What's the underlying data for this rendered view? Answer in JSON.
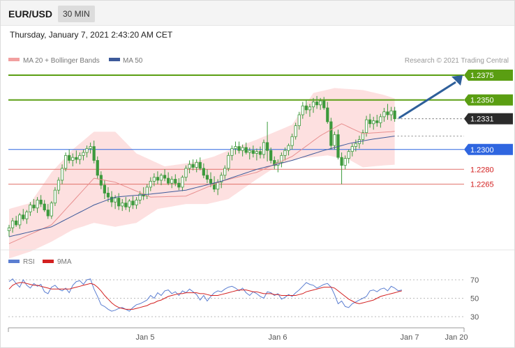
{
  "header": {
    "symbol": "EUR/USD",
    "timeframe": "30 MIN",
    "timestamp": "Thursday, January 7, 2021 2:43:20 AM CET"
  },
  "colors": {
    "candle": "#3c9a3c",
    "bollinger_fill": "#fde0e0",
    "ma20": "#e88f8f",
    "ma50": "#3d5a9a",
    "resistance_line": "#5a9e12",
    "support_line": "#2f66e0",
    "target_line": "#e0706a",
    "current_price_bg": "#2b2b2b",
    "arrow": "#2e5f9a",
    "rsi": "#5b7ed1",
    "rsi_ma": "#d32020"
  },
  "chart_data": [
    {
      "type": "candlestick",
      "legend": [
        "MA 20 + Bollinger Bands",
        "MA 50"
      ],
      "legend_position": "top-left",
      "credit": "Research © 2021 Trading Central",
      "x_ticks": [
        "Jan 5",
        "Jan 6",
        "Jan 7",
        "Jan 20"
      ],
      "price_levels": [
        {
          "label": "1.2375",
          "value": 1.2375,
          "kind": "resistance"
        },
        {
          "label": "1.2350",
          "value": 1.235,
          "kind": "resistance"
        },
        {
          "label": "1.2331",
          "value": 1.2331,
          "kind": "current"
        },
        {
          "label": "1.2300",
          "value": 1.23,
          "kind": "pivot"
        },
        {
          "label": "1.2280",
          "value": 1.228,
          "kind": "support"
        },
        {
          "label": "1.2265",
          "value": 1.2265,
          "kind": "support"
        }
      ],
      "arrow": {
        "from": 1.2331,
        "to": 1.2375,
        "direction": "up"
      },
      "candles": [
        [
          1.2218,
          1.2224,
          1.2212,
          1.2221
        ],
        [
          1.2221,
          1.2231,
          1.2216,
          1.2228
        ],
        [
          1.2228,
          1.2233,
          1.2222,
          1.2224
        ],
        [
          1.2224,
          1.2236,
          1.222,
          1.2234
        ],
        [
          1.2234,
          1.224,
          1.2228,
          1.223
        ],
        [
          1.223,
          1.2239,
          1.2225,
          1.2237
        ],
        [
          1.2237,
          1.2247,
          1.2233,
          1.2244
        ],
        [
          1.2244,
          1.225,
          1.2238,
          1.2241
        ],
        [
          1.2241,
          1.2252,
          1.2236,
          1.2249
        ],
        [
          1.2249,
          1.2254,
          1.2242,
          1.2245
        ],
        [
          1.2245,
          1.2249,
          1.2237,
          1.2239
        ],
        [
          1.2239,
          1.2245,
          1.223,
          1.2233
        ],
        [
          1.2233,
          1.2248,
          1.223,
          1.2246
        ],
        [
          1.2246,
          1.2262,
          1.2243,
          1.2259
        ],
        [
          1.2259,
          1.2272,
          1.2255,
          1.2269
        ],
        [
          1.2269,
          1.2285,
          1.2265,
          1.2281
        ],
        [
          1.2281,
          1.2297,
          1.2278,
          1.2294
        ],
        [
          1.2294,
          1.23,
          1.2286,
          1.2289
        ],
        [
          1.2289,
          1.2296,
          1.2283,
          1.2292
        ],
        [
          1.2292,
          1.2299,
          1.2286,
          1.229
        ],
        [
          1.229,
          1.2297,
          1.2285,
          1.2294
        ],
        [
          1.2294,
          1.23,
          1.2289,
          1.2297
        ],
        [
          1.2297,
          1.2304,
          1.2292,
          1.2301
        ],
        [
          1.2301,
          1.2307,
          1.2296,
          1.2303
        ],
        [
          1.2303,
          1.2309,
          1.2286,
          1.2289
        ],
        [
          1.2289,
          1.2293,
          1.227,
          1.2274
        ],
        [
          1.2274,
          1.2278,
          1.226,
          1.2264
        ],
        [
          1.2264,
          1.2269,
          1.225,
          1.2256
        ],
        [
          1.2256,
          1.2262,
          1.2247,
          1.2252
        ],
        [
          1.2252,
          1.2258,
          1.2242,
          1.2247
        ],
        [
          1.2247,
          1.2254,
          1.224,
          1.2251
        ],
        [
          1.2251,
          1.2256,
          1.2239,
          1.2243
        ],
        [
          1.2243,
          1.225,
          1.2238,
          1.2246
        ],
        [
          1.2246,
          1.2252,
          1.2239,
          1.2242
        ],
        [
          1.2242,
          1.225,
          1.2237,
          1.2248
        ],
        [
          1.2248,
          1.2253,
          1.224,
          1.2244
        ],
        [
          1.2244,
          1.2252,
          1.224,
          1.2249
        ],
        [
          1.2249,
          1.2258,
          1.2245,
          1.2255
        ],
        [
          1.2255,
          1.2262,
          1.2249,
          1.2253
        ],
        [
          1.2253,
          1.2265,
          1.225,
          1.2262
        ],
        [
          1.2262,
          1.2272,
          1.2258,
          1.2268
        ],
        [
          1.2268,
          1.2276,
          1.2263,
          1.2272
        ],
        [
          1.2272,
          1.2278,
          1.2265,
          1.2269
        ],
        [
          1.2269,
          1.2276,
          1.2264,
          1.2274
        ],
        [
          1.2274,
          1.228,
          1.2268,
          1.2271
        ],
        [
          1.2271,
          1.2277,
          1.2264,
          1.2266
        ],
        [
          1.2266,
          1.2273,
          1.2261,
          1.227
        ],
        [
          1.227,
          1.2275,
          1.2263,
          1.2266
        ],
        [
          1.2266,
          1.2271,
          1.2259,
          1.2262
        ],
        [
          1.2262,
          1.2274,
          1.2258,
          1.2272
        ],
        [
          1.2272,
          1.2284,
          1.2268,
          1.2281
        ],
        [
          1.2281,
          1.2289,
          1.2276,
          1.2285
        ],
        [
          1.2285,
          1.229,
          1.2279,
          1.2282
        ],
        [
          1.2282,
          1.229,
          1.2277,
          1.2287
        ],
        [
          1.2287,
          1.2292,
          1.2279,
          1.2281
        ],
        [
          1.2281,
          1.2286,
          1.2271,
          1.2274
        ],
        [
          1.2274,
          1.228,
          1.2266,
          1.227
        ],
        [
          1.227,
          1.2277,
          1.2262,
          1.2266
        ],
        [
          1.2266,
          1.2273,
          1.2257,
          1.226
        ],
        [
          1.226,
          1.227,
          1.2254,
          1.2267
        ],
        [
          1.2267,
          1.2277,
          1.2261,
          1.2274
        ],
        [
          1.2274,
          1.2284,
          1.227,
          1.2281
        ],
        [
          1.2281,
          1.2297,
          1.2278,
          1.2294
        ],
        [
          1.2294,
          1.2304,
          1.2289,
          1.2301
        ],
        [
          1.2301,
          1.2308,
          1.2295,
          1.2303
        ],
        [
          1.2303,
          1.2308,
          1.2296,
          1.2299
        ],
        [
          1.2299,
          1.2305,
          1.2293,
          1.2302
        ],
        [
          1.2302,
          1.2307,
          1.2295,
          1.2297
        ],
        [
          1.2297,
          1.2302,
          1.229,
          1.2299
        ],
        [
          1.2299,
          1.2304,
          1.2292,
          1.2296
        ],
        [
          1.2296,
          1.2301,
          1.2289,
          1.2298
        ],
        [
          1.2298,
          1.2303,
          1.2291,
          1.2295
        ],
        [
          1.2295,
          1.231,
          1.2291,
          1.2307
        ],
        [
          1.2307,
          1.2328,
          1.2288,
          1.2299
        ],
        [
          1.2299,
          1.2302,
          1.2286,
          1.2289
        ],
        [
          1.2289,
          1.2293,
          1.228,
          1.2284
        ],
        [
          1.2284,
          1.229,
          1.2277,
          1.2287
        ],
        [
          1.2287,
          1.2297,
          1.2282,
          1.2294
        ],
        [
          1.2294,
          1.2302,
          1.2289,
          1.2299
        ],
        [
          1.2299,
          1.2306,
          1.2294,
          1.2304
        ],
        [
          1.2304,
          1.2316,
          1.23,
          1.2313
        ],
        [
          1.2313,
          1.2327,
          1.231,
          1.2324
        ],
        [
          1.2324,
          1.2338,
          1.232,
          1.2335
        ],
        [
          1.2335,
          1.2348,
          1.2331,
          1.2344
        ],
        [
          1.2344,
          1.235,
          1.2336,
          1.234
        ],
        [
          1.234,
          1.2346,
          1.2333,
          1.2343
        ],
        [
          1.2343,
          1.2352,
          1.2337,
          1.2348
        ],
        [
          1.2348,
          1.2354,
          1.2341,
          1.2345
        ],
        [
          1.2345,
          1.2352,
          1.234,
          1.2349
        ],
        [
          1.2349,
          1.2353,
          1.234,
          1.2342
        ],
        [
          1.2342,
          1.2348,
          1.2326,
          1.2328
        ],
        [
          1.2328,
          1.2332,
          1.23,
          1.2304
        ],
        [
          1.2304,
          1.2318,
          1.23,
          1.2315
        ],
        [
          1.2315,
          1.232,
          1.229,
          1.2292
        ],
        [
          1.2292,
          1.2297,
          1.2265,
          1.2284
        ],
        [
          1.2284,
          1.2294,
          1.228,
          1.2291
        ],
        [
          1.2291,
          1.23,
          1.2286,
          1.2298
        ],
        [
          1.2298,
          1.2306,
          1.2293,
          1.2303
        ],
        [
          1.2303,
          1.231,
          1.2298,
          1.2306
        ],
        [
          1.2306,
          1.2314,
          1.2301,
          1.231
        ],
        [
          1.231,
          1.232,
          1.2305,
          1.2317
        ],
        [
          1.2317,
          1.2334,
          1.2313,
          1.233
        ],
        [
          1.233,
          1.2336,
          1.2322,
          1.2326
        ],
        [
          1.2326,
          1.2333,
          1.232,
          1.2329
        ],
        [
          1.2329,
          1.2335,
          1.2323,
          1.2327
        ],
        [
          1.2327,
          1.2336,
          1.2322,
          1.2333
        ],
        [
          1.2333,
          1.2342,
          1.2328,
          1.2338
        ],
        [
          1.2338,
          1.2346,
          1.233,
          1.2335
        ],
        [
          1.2335,
          1.2343,
          1.2329,
          1.2339
        ],
        [
          1.2339,
          1.2343,
          1.2328,
          1.2331
        ]
      ],
      "ma20": [
        [
          0,
          1.2205
        ],
        [
          12,
          1.2224
        ],
        [
          24,
          1.2271
        ],
        [
          30,
          1.2267
        ],
        [
          40,
          1.2252
        ],
        [
          50,
          1.2253
        ],
        [
          60,
          1.2268
        ],
        [
          70,
          1.2277
        ],
        [
          80,
          1.2293
        ],
        [
          88,
          1.2314
        ],
        [
          94,
          1.2326
        ],
        [
          100,
          1.2316
        ],
        [
          108,
          1.2318
        ],
        [
          115,
          1.2321
        ]
      ],
      "bollinger_upper": [
        [
          0,
          1.224
        ],
        [
          6,
          1.2246
        ],
        [
          12,
          1.2277
        ],
        [
          18,
          1.23
        ],
        [
          24,
          1.2318
        ],
        [
          30,
          1.2318
        ],
        [
          36,
          1.2296
        ],
        [
          44,
          1.2283
        ],
        [
          52,
          1.2287
        ],
        [
          58,
          1.2293
        ],
        [
          64,
          1.2302
        ],
        [
          70,
          1.231
        ],
        [
          74,
          1.2316
        ],
        [
          80,
          1.2325
        ],
        [
          86,
          1.2357
        ],
        [
          92,
          1.2362
        ],
        [
          100,
          1.236
        ],
        [
          106,
          1.2355
        ],
        [
          112,
          1.2348
        ],
        [
          115,
          1.2346
        ]
      ],
      "bollinger_lower": [
        [
          0,
          1.219
        ],
        [
          6,
          1.2197
        ],
        [
          12,
          1.2207
        ],
        [
          18,
          1.2219
        ],
        [
          24,
          1.2226
        ],
        [
          30,
          1.2222
        ],
        [
          36,
          1.2226
        ],
        [
          42,
          1.224
        ],
        [
          50,
          1.2245
        ],
        [
          56,
          1.2245
        ],
        [
          62,
          1.225
        ],
        [
          70,
          1.227
        ],
        [
          76,
          1.2284
        ],
        [
          82,
          1.2291
        ],
        [
          90,
          1.2294
        ],
        [
          96,
          1.229
        ],
        [
          100,
          1.2282
        ],
        [
          106,
          1.2284
        ],
        [
          115,
          1.2286
        ]
      ],
      "ma50": [
        [
          0,
          1.2212
        ],
        [
          12,
          1.2222
        ],
        [
          24,
          1.2244
        ],
        [
          30,
          1.2252
        ],
        [
          40,
          1.2255
        ],
        [
          50,
          1.2259
        ],
        [
          60,
          1.2268
        ],
        [
          70,
          1.228
        ],
        [
          80,
          1.2289
        ],
        [
          88,
          1.2298
        ],
        [
          96,
          1.2306
        ],
        [
          102,
          1.231
        ],
        [
          108,
          1.2313
        ],
        [
          115,
          1.2317
        ]
      ]
    },
    {
      "type": "line",
      "legend": [
        "RSI",
        "9MA"
      ],
      "legend_position": "top-left",
      "y_ticks": [
        "70",
        "50",
        "30"
      ],
      "ylim": [
        20,
        80
      ],
      "x_ticks": [
        "Jan 5",
        "Jan 6",
        "Jan 7",
        "Jan 20"
      ],
      "series": [
        {
          "name": "RSI",
          "values": [
            68,
            71,
            66,
            62,
            70,
            64,
            61,
            66,
            63,
            65,
            57,
            55,
            62,
            64,
            60,
            58,
            61,
            56,
            64,
            68,
            69,
            65,
            70,
            71,
            60,
            52,
            43,
            41,
            38,
            36,
            37,
            39,
            40,
            38,
            36,
            40,
            43,
            44,
            46,
            48,
            53,
            50,
            56,
            53,
            58,
            59,
            55,
            57,
            53,
            58,
            56,
            60,
            57,
            54,
            48,
            53,
            47,
            52,
            56,
            58,
            57,
            60,
            62,
            63,
            61,
            58,
            61,
            56,
            53,
            57,
            55,
            52,
            50,
            57,
            56,
            53,
            55,
            49,
            51,
            54,
            52,
            56,
            59,
            63,
            67,
            65,
            64,
            61,
            63,
            65,
            66,
            62,
            54,
            44,
            47,
            41,
            40,
            44,
            46,
            48,
            50,
            52,
            58,
            59,
            57,
            60,
            61,
            58,
            63,
            61,
            58,
            59
          ]
        },
        {
          "name": "9MA",
          "values": [
            60,
            64,
            66,
            67,
            67,
            66,
            65,
            64,
            64,
            63,
            62,
            61,
            60,
            60,
            60,
            60,
            60,
            60,
            61,
            62,
            63,
            64,
            65,
            66,
            65,
            62,
            58,
            53,
            49,
            45,
            42,
            40,
            39,
            38,
            38,
            38,
            39,
            40,
            41,
            42,
            44,
            45,
            47,
            48,
            50,
            52,
            53,
            54,
            55,
            55,
            56,
            56,
            56,
            56,
            55,
            55,
            54,
            53,
            53,
            53,
            54,
            55,
            56,
            57,
            58,
            59,
            59,
            59,
            58,
            57,
            57,
            56,
            55,
            55,
            55,
            54,
            54,
            53,
            53,
            53,
            53,
            53,
            54,
            55,
            57,
            58,
            59,
            60,
            61,
            62,
            62,
            62,
            61,
            58,
            55,
            52,
            49,
            47,
            45,
            44,
            45,
            46,
            47,
            48,
            50,
            52,
            53,
            54,
            55,
            56,
            57,
            58
          ]
        }
      ]
    }
  ]
}
